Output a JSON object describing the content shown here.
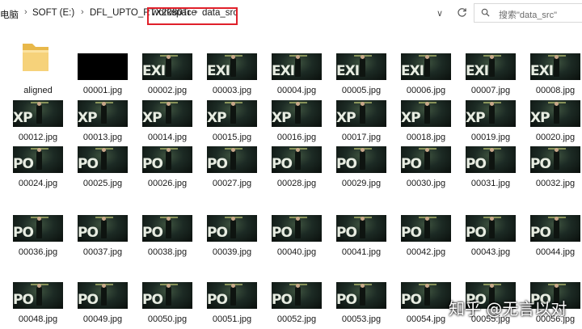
{
  "address": {
    "crumbs": [
      "电脑",
      "SOFT (E:)",
      "DFL_UPTO_RTX2080Ti",
      "workspace",
      "data_src"
    ]
  },
  "search": {
    "placeholder": "搜索\"data_src\""
  },
  "folder": {
    "label": "aligned",
    "icon": "folder-icon"
  },
  "files": [
    "00001.jpg",
    "00002.jpg",
    "00003.jpg",
    "00004.jpg",
    "00005.jpg",
    "00006.jpg",
    "00007.jpg",
    "00008.jpg",
    "00012.jpg",
    "00013.jpg",
    "00014.jpg",
    "00015.jpg",
    "00016.jpg",
    "00017.jpg",
    "00018.jpg",
    "00019.jpg",
    "00020.jpg",
    "00024.jpg",
    "00025.jpg",
    "00026.jpg",
    "00027.jpg",
    "00028.jpg",
    "00029.jpg",
    "00030.jpg",
    "00031.jpg",
    "00032.jpg",
    "00036.jpg",
    "00037.jpg",
    "00038.jpg",
    "00039.jpg",
    "00040.jpg",
    "00041.jpg",
    "00042.jpg",
    "00043.jpg",
    "00044.jpg",
    "00048.jpg",
    "00049.jpg",
    "00050.jpg",
    "00051.jpg",
    "00052.jpg",
    "00053.jpg",
    "00054.jpg",
    "00055.jpg",
    "00056.jpg"
  ],
  "watermark": "知乎 @无言以对",
  "colors": {
    "highlight_box": "#e0202a"
  }
}
